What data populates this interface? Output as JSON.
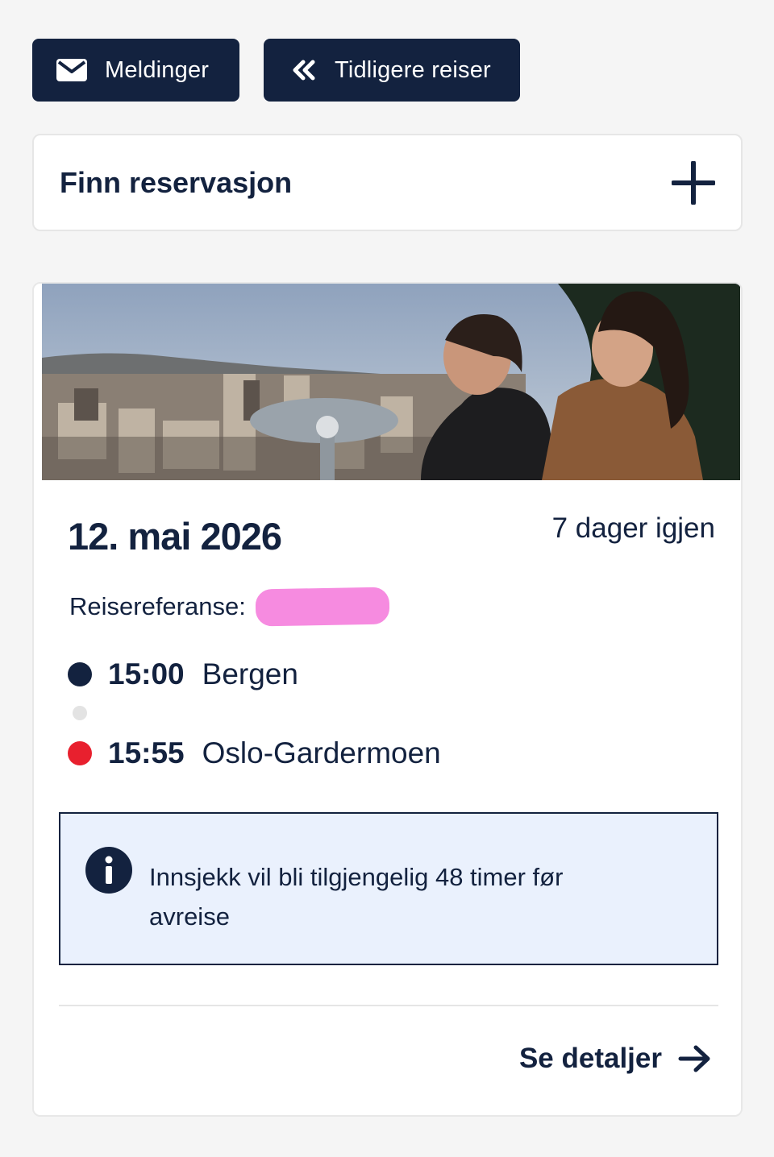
{
  "top_buttons": {
    "messages_label": "Meldinger",
    "messages_icon": "envelope-icon",
    "previous_label": "Tidligere reiser",
    "previous_icon": "double-chevron-left-icon"
  },
  "find_reservation": {
    "title": "Finn reservasjon",
    "icon": "plus-icon"
  },
  "trip": {
    "date": "12. mai 2026",
    "days_left": "7 dager igjen",
    "reference_label": "Reisereferanse:",
    "departure": {
      "time": "15:00",
      "place": "Bergen",
      "dot_color": "#13223f"
    },
    "arrival": {
      "time": "15:55",
      "place": "Oslo-Gardermoen",
      "dot_color": "#e8202e"
    },
    "info_text": "Innsjekk vil bli tilgjengelig 48 timer før avreise",
    "info_icon": "info-icon",
    "details_label": "Se detaljer",
    "details_icon": "arrow-right-icon"
  },
  "colors": {
    "navy": "#13223f",
    "red": "#e8202e",
    "info_bg": "#eaf1fd",
    "redaction": "#f68be0"
  }
}
